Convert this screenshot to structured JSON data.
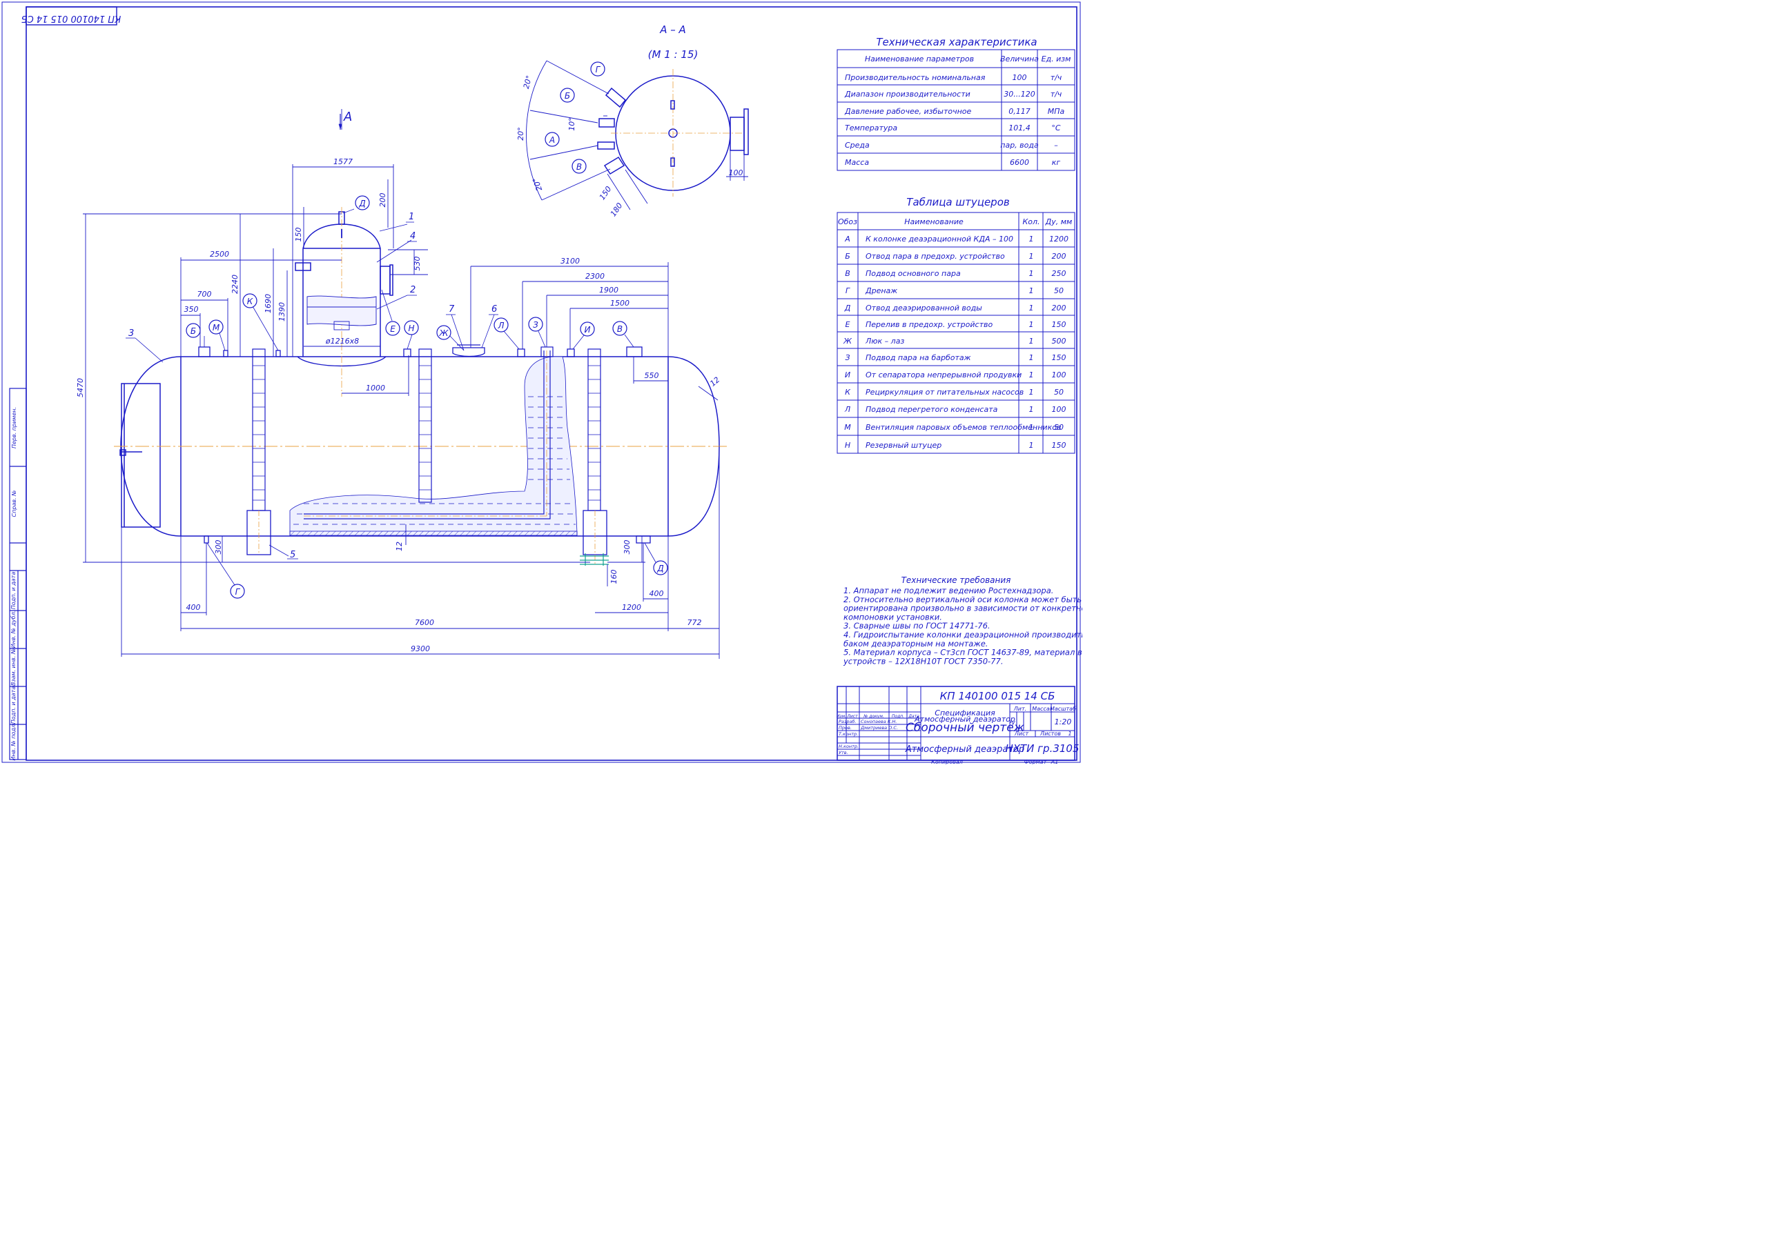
{
  "stamp_code_rotated": "КП 140100 015 14 СБ",
  "section": {
    "title": "А – А",
    "scale": "(М 1 : 15)",
    "view_label": "А"
  },
  "dims": {
    "d1577": "1577",
    "d200": "200",
    "d150t": "150",
    "d530": "530",
    "d2240": "2240",
    "d1690": "1690",
    "d1390": "1390",
    "d5470": "5470",
    "d2500": "2500",
    "d700": "700",
    "d350": "350",
    "dia": "ø1216х8",
    "d1000": "1000",
    "d3100": "3100",
    "d2300": "2300",
    "d1900": "1900",
    "d1500": "1500",
    "d550": "550",
    "d12a": "12",
    "d12b": "12",
    "d300a": "300",
    "d300b": "300",
    "d160": "160",
    "d400a": "400",
    "d400b": "400",
    "d1200": "1200",
    "d7600": "7600",
    "d772": "772",
    "d9300": "9300",
    "a20a": "20°",
    "a20b": "20°",
    "a20c": "20°",
    "a10": "10°",
    "s150": "150",
    "s180": "180",
    "s100": "100"
  },
  "callouts": {
    "B": "Б",
    "M": "М",
    "K": "К",
    "D": "Д",
    "E": "Е",
    "N": "Н",
    "Zh": "Ж",
    "L": "Л",
    "Z": "З",
    "I": "И",
    "V": "В",
    "G": "Г",
    "D2": "Д",
    "G2": "Г",
    "B2": "Б",
    "A2": "А",
    "V2": "В"
  },
  "positions": {
    "p1": "1",
    "p2": "2",
    "p3": "3",
    "p4": "4",
    "p5": "5",
    "p6": "6",
    "p7": "7"
  },
  "tech_char": {
    "title": "Техническая характеристика",
    "headers": [
      "Наименование параметров",
      "Величина",
      "Ед. изм"
    ],
    "rows": [
      [
        "Производительность номинальная",
        "100",
        "т/ч"
      ],
      [
        "Диапазон производительности",
        "30...120",
        "т/ч"
      ],
      [
        "Давление рабочее, избыточное",
        "0,117",
        "МПа"
      ],
      [
        "Температура",
        "101,4",
        "°С"
      ],
      [
        "Среда",
        "пар, вода",
        "–"
      ],
      [
        "Масса",
        "6600",
        "кг"
      ]
    ]
  },
  "nozzles": {
    "title": "Таблица штуцеров",
    "headers": [
      "Обоз",
      "Наименование",
      "Кол.",
      "Ду, мм"
    ],
    "rows": [
      [
        "А",
        "К колонке деаэрационной КДА – 100",
        "1",
        "1200"
      ],
      [
        "Б",
        "Отвод пара в предохр. устройство",
        "1",
        "200"
      ],
      [
        "В",
        "Подвод основного пара",
        "1",
        "250"
      ],
      [
        "Г",
        "Дренаж",
        "1",
        "50"
      ],
      [
        "Д",
        "Отвод деаэрированной воды",
        "1",
        "200"
      ],
      [
        "Е",
        "Перелив в предохр. устройство",
        "1",
        "150"
      ],
      [
        "Ж",
        "Люк – лаз",
        "1",
        "500"
      ],
      [
        "З",
        "Подвод пара на барботаж",
        "1",
        "150"
      ],
      [
        "И",
        "От сепаратора непрерывной продувки",
        "1",
        "100"
      ],
      [
        "К",
        "Рециркуляция от питательных насосов",
        "1",
        "50"
      ],
      [
        "Л",
        "Подвод перегретого конденсата",
        "1",
        "100"
      ],
      [
        "М",
        "Вентиляция паровых объемов теплообменников",
        "1",
        "50"
      ],
      [
        "Н",
        "Резервный штуцер",
        "1",
        "150"
      ]
    ]
  },
  "requirements": {
    "title": "Технические требования",
    "lines": [
      "1. Аппарат не подлежит ведению Ростехнадзора.",
      "2. Относительно вертикальной оси колонка может быть",
      "ориентирована произвольно в зависимости от конкретной",
      "компоновки установки.",
      "3. Сварные швы по ГОСТ 14771-76.",
      "4. Гидроиспытание колонки деаэрационной производить в сборе с",
      "баком деаэраторным на монтаже.",
      "5. Материал корпуса – Ст3сп ГОСТ 14637-89, материал внутренних",
      "устройств – 12Х18Н10Т ГОСТ 7350-77."
    ]
  },
  "left_strip": [
    "Перв. примен.",
    "Справ. №",
    "Подп. и дата",
    "Инв. № дубл.",
    "Взам. инв. №",
    "Подп. и дата",
    "Инв. № подл."
  ],
  "title_block": {
    "code": "КП 140100 015 14 СБ",
    "name_over1": "Спецификация",
    "name_over2": "Атмосферный деаэратор",
    "name_main": "Сборочный чертеж",
    "object": "Атмосферный деаэратор",
    "org": "НХТИ гр.3105",
    "lit_h": "Лит.",
    "mass_h": "Масса",
    "scale_h": "Масштаб",
    "lit": "у",
    "scale": "1:20",
    "sheet_h": "Лист",
    "sheets_h": "Листов",
    "sheets": "1",
    "col_h": [
      "Изм.",
      "Лист",
      "№ докум.",
      "Подп.",
      "Дата"
    ],
    "roles": [
      [
        "Разраб.",
        "Сонопаева К.Н."
      ],
      [
        "Пров.",
        "Дмитриева О.С."
      ],
      [
        "Т.контр.",
        ""
      ],
      [
        "",
        ""
      ],
      [
        "Н.контр.",
        ""
      ],
      [
        "Утв.",
        ""
      ]
    ],
    "copied": "Копировал",
    "format_h": "Формат",
    "format": "А1"
  }
}
